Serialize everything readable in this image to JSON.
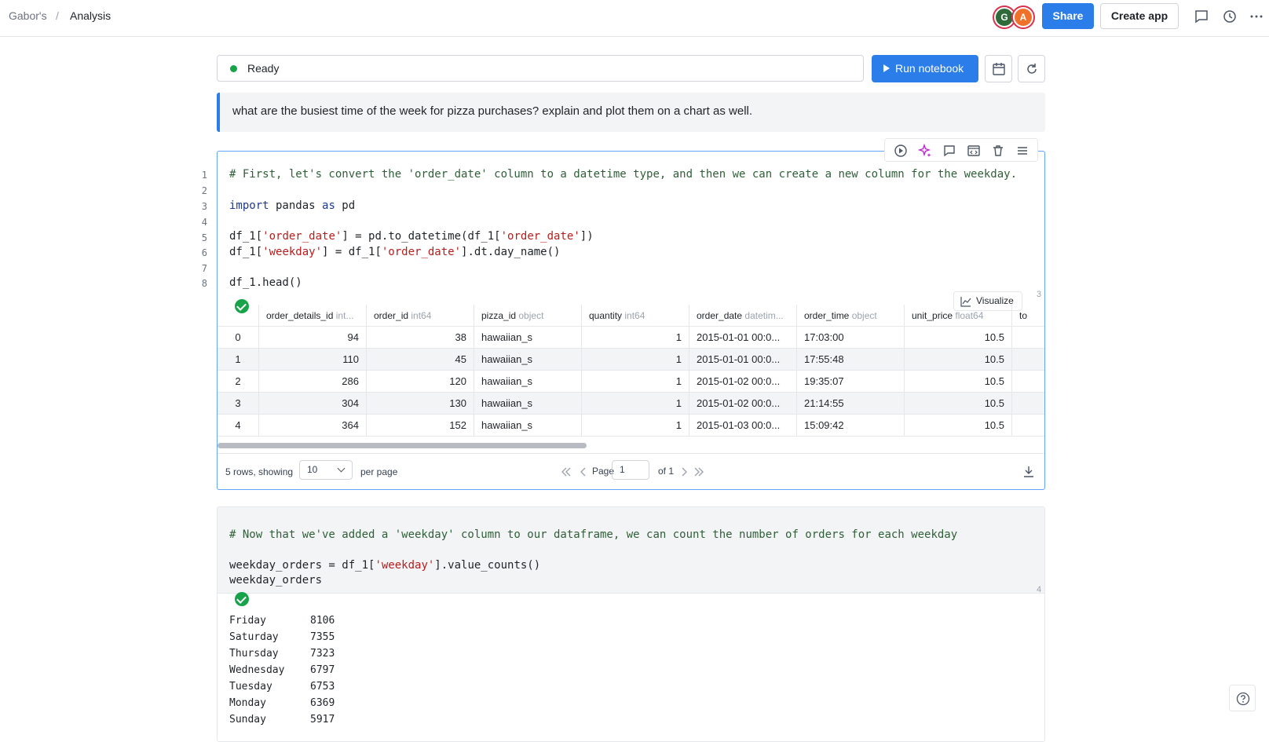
{
  "breadcrumb": {
    "root": "Gabor's",
    "separator": "/",
    "current": "Analysis"
  },
  "header": {
    "avatars": [
      {
        "initial": "G",
        "color": "#2f6b3a"
      },
      {
        "initial": "A",
        "color": "#f0712a"
      }
    ],
    "share_label": "Share",
    "create_app_label": "Create app",
    "icons": [
      "comment-icon",
      "history-icon",
      "more-icon"
    ]
  },
  "status": {
    "text": "Ready",
    "color": "#16a34a"
  },
  "run_button_label": "Run notebook",
  "prompt_text": "what are the busiest time of the week for pizza purchases? explain and plot them on a chart as well.",
  "cell1": {
    "number": "3",
    "line_numbers": [
      "1",
      "2",
      "3",
      "4",
      "5",
      "6",
      "7",
      "8"
    ],
    "code": {
      "l1": "# First, let's convert the 'order_date' column to a datetime type, and then we can create a new column for the weekday.",
      "l3_kw1": "import",
      "l3_mid": " pandas ",
      "l3_kw2": "as",
      "l3_end": " pd",
      "l5_a": "df_1[",
      "l5_s1": "'order_date'",
      "l5_b": "] = pd.to_datetime(df_1[",
      "l5_s2": "'order_date'",
      "l5_c": "])",
      "l6_a": "df_1[",
      "l6_s1": "'weekday'",
      "l6_b": "] = df_1[",
      "l6_s2": "'order_date'",
      "l6_c": "].dt.day_name()",
      "l8": "df_1.head()"
    },
    "visualize_label": "Visualize",
    "table": {
      "columns": [
        {
          "name": "order_details_id",
          "dtype": "int..."
        },
        {
          "name": "order_id",
          "dtype": "int64"
        },
        {
          "name": "pizza_id",
          "dtype": "object"
        },
        {
          "name": "quantity",
          "dtype": "int64"
        },
        {
          "name": "order_date",
          "dtype": "datetim..."
        },
        {
          "name": "order_time",
          "dtype": "object"
        },
        {
          "name": "unit_price",
          "dtype": "float64"
        },
        {
          "name": "to",
          "dtype": ""
        }
      ],
      "rows": [
        {
          "idx": "0",
          "cells": [
            "94",
            "38",
            "hawaiian_s",
            "1",
            "2015-01-01 00:0...",
            "17:03:00",
            "10.5"
          ]
        },
        {
          "idx": "1",
          "cells": [
            "110",
            "45",
            "hawaiian_s",
            "1",
            "2015-01-01 00:0...",
            "17:55:48",
            "10.5"
          ]
        },
        {
          "idx": "2",
          "cells": [
            "286",
            "120",
            "hawaiian_s",
            "1",
            "2015-01-02 00:0...",
            "19:35:07",
            "10.5"
          ]
        },
        {
          "idx": "3",
          "cells": [
            "304",
            "130",
            "hawaiian_s",
            "1",
            "2015-01-02 00:0...",
            "21:14:55",
            "10.5"
          ]
        },
        {
          "idx": "4",
          "cells": [
            "364",
            "152",
            "hawaiian_s",
            "1",
            "2015-01-03 00:0...",
            "15:09:42",
            "10.5"
          ]
        }
      ]
    },
    "pager": {
      "rows_text": "5 rows, showing",
      "per_page_value": "10",
      "per_page_label": "per page",
      "page_label": "Page",
      "page_value": "1",
      "of_label": "of 1"
    }
  },
  "cell2": {
    "number": "4",
    "code": {
      "l1": "# Now that we've added a 'weekday' column to our dataframe, we can count the number of orders for each weekday",
      "l3_a": "weekday_orders = df_1[",
      "l3_s": "'weekday'",
      "l3_b": "].value_counts()",
      "l4": "weekday_orders"
    },
    "output": [
      {
        "day": "Friday",
        "count": "8106"
      },
      {
        "day": "Saturday",
        "count": "7355"
      },
      {
        "day": "Thursday",
        "count": "7323"
      },
      {
        "day": "Wednesday",
        "count": "6797"
      },
      {
        "day": "Tuesday",
        "count": "6753"
      },
      {
        "day": "Monday",
        "count": "6369"
      },
      {
        "day": "Sunday",
        "count": "5917"
      }
    ]
  }
}
